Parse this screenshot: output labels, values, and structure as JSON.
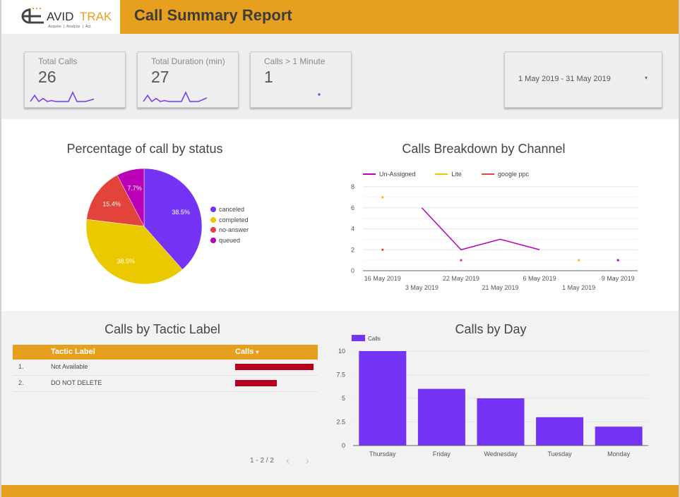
{
  "header": {
    "logo": {
      "name": "AVIDTRAK",
      "name_part1": "AVID",
      "name_part2": "TRAK",
      "tagline": "Acquire  |  Analyze  |  Act"
    },
    "title": "Call Summary Report"
  },
  "colors": {
    "brand_orange": "#e6a01e",
    "accent_purple": "#7433f5",
    "bar_red": "#b8001f"
  },
  "kpis": [
    {
      "label": "Total Calls",
      "value": "26",
      "sparkline": [
        1,
        3,
        1,
        2,
        1,
        1.3,
        1,
        1,
        1,
        1,
        4,
        1,
        1,
        1,
        1.4,
        1.8
      ]
    },
    {
      "label": "Total Duration (min)",
      "value": "27",
      "sparkline": [
        1,
        3,
        1,
        2,
        1,
        1.3,
        1,
        1,
        1,
        1,
        4,
        1,
        1,
        1,
        1.6,
        2.2
      ]
    },
    {
      "label": "Calls > 1 Minute",
      "value": "1",
      "sparkline": [
        1
      ]
    }
  ],
  "date_range": {
    "value": "1 May 2019 - 31 May 2019",
    "caret_icon": "▾"
  },
  "chart_data": [
    {
      "type": "pie",
      "title": "Percentage of call by status",
      "legend_position": "right",
      "slices": [
        {
          "label": "canceled",
          "value": 38.5,
          "display": "38.5%",
          "color": "#7433f5"
        },
        {
          "label": "completed",
          "value": 38.5,
          "display": "38.5%",
          "color": "#eac900"
        },
        {
          "label": "no-answer",
          "value": 15.4,
          "display": "15.4%",
          "color": "#e2433b"
        },
        {
          "label": "queued",
          "value": 7.7,
          "display": "7.7%",
          "color": "#bc00b7"
        }
      ]
    },
    {
      "type": "line",
      "title": "Calls Breakdown by Channel",
      "legend_position": "top-left",
      "categories": [
        "16 May 2019",
        "3 May 2019",
        "22 May 2019",
        "21 May 2019",
        "6 May 2019",
        "1 May 2019",
        "9 May 2019"
      ],
      "ylim": [
        0,
        8
      ],
      "yticks": [
        0,
        2,
        4,
        6,
        8
      ],
      "grid": true,
      "series": [
        {
          "name": "Un-Assigned",
          "color": "#bc00b7",
          "values": [
            null,
            6,
            2,
            3,
            2,
            null,
            1
          ]
        },
        {
          "name": "Lite",
          "color": "#f2c300",
          "values": [
            7,
            null,
            null,
            null,
            null,
            1,
            null
          ]
        },
        {
          "name": "google ppc",
          "color": "#e2433b",
          "values": [
            2,
            null,
            1,
            null,
            null,
            null,
            null
          ]
        }
      ]
    },
    {
      "type": "table",
      "title": "Calls by Tactic Label",
      "columns": [
        "Tactic Label",
        "Calls"
      ],
      "sort_icon": "▾",
      "rows": [
        {
          "index": "1.",
          "label": "Not Available",
          "calls_fraction": 1.0
        },
        {
          "index": "2.",
          "label": "DO NOT DELETE",
          "calls_fraction": 0.53
        }
      ],
      "pagination": {
        "text": "1 - 2 / 2",
        "prev_icon": "‹",
        "next_icon": "›"
      }
    },
    {
      "type": "bar",
      "title": "Calls by Day",
      "legend_position": "top-left",
      "series": [
        {
          "name": "Calls",
          "color": "#7433f5"
        }
      ],
      "categories": [
        "Thursday",
        "Friday",
        "Wednesday",
        "Tuesday",
        "Monday"
      ],
      "values": [
        10,
        6,
        5,
        3,
        2
      ],
      "ylim": [
        0,
        10
      ],
      "yticks": [
        "0",
        "2.5",
        "5",
        "7.5",
        "10"
      ],
      "grid": true
    }
  ]
}
